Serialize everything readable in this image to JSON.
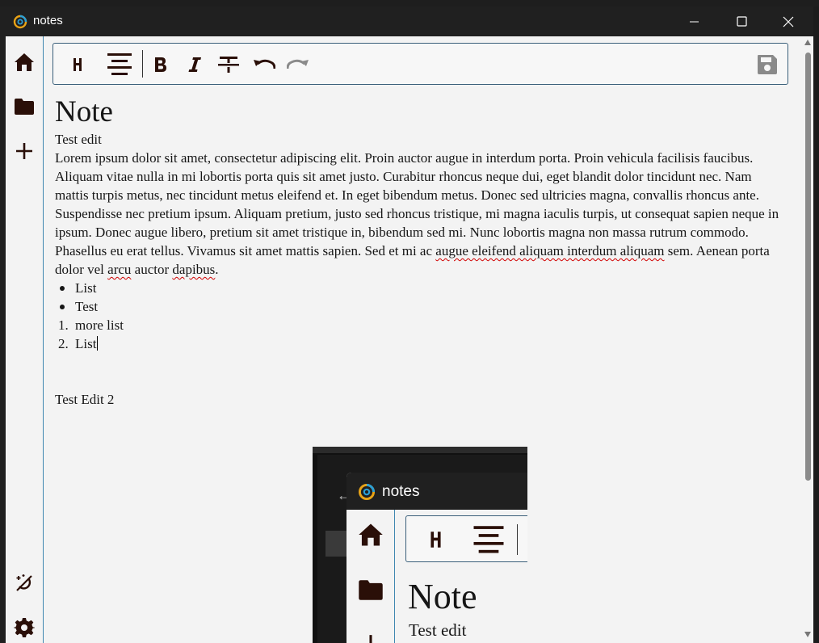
{
  "window": {
    "title": "notes",
    "controls": [
      "minimize",
      "maximize",
      "close"
    ]
  },
  "sidebar": {
    "top_items": [
      {
        "icon": "home-icon"
      },
      {
        "icon": "folder-icon"
      },
      {
        "icon": "plus-icon"
      }
    ],
    "bottom_items": [
      {
        "icon": "theme-toggle-icon"
      },
      {
        "icon": "gear-icon"
      }
    ]
  },
  "toolbar": {
    "buttons": [
      {
        "icon": "heading-icon",
        "label": "H"
      },
      {
        "icon": "align-center-icon"
      },
      {
        "icon": "bold-icon",
        "label": "B"
      },
      {
        "icon": "italic-icon",
        "label": "I"
      },
      {
        "icon": "strikethrough-icon"
      },
      {
        "icon": "undo-icon"
      },
      {
        "icon": "redo-icon"
      }
    ],
    "save": {
      "icon": "save-icon"
    }
  },
  "note": {
    "title": "Note",
    "subtitle": "Test edit",
    "paragraph_parts": [
      {
        "text": "Lorem ipsum dolor sit amet, consectetur adipiscing elit. Proin auctor augue in interdum porta. Proin vehicula facilisis faucibus. Aliquam vitae nulla in mi lobortis porta quis sit amet justo. Curabitur rhoncus neque dui, eget blandit dolor tincidunt nec. Nam mattis turpis metus, nec tincidunt metus eleifend et. In eget bibendum metus. Donec sed ultricies magna, convallis rhoncus ante. Suspendisse nec pretium ipsum. Aliquam pretium, justo sed rhoncus tristique, mi magna iaculis turpis, ut consequat sapien neque in ipsum. Donec augue libero, pretium sit amet tristique in, bibendum sed mi. Nunc lobortis magna non massa rutrum commodo. Phasellus eu erat tellus. Vivamus sit amet mattis sapien. Sed et mi ac ",
        "spell": false
      },
      {
        "text": "augue eleifend aliquam interdum aliquam",
        "spell": true
      },
      {
        "text": " sem. Aenean porta dolor vel ",
        "spell": false
      },
      {
        "text": "arcu",
        "spell": true
      },
      {
        "text": " auctor ",
        "spell": false
      },
      {
        "text": "dapibus",
        "spell": true
      },
      {
        "text": ".",
        "spell": false
      }
    ],
    "bullet_list": [
      "List",
      "Test"
    ],
    "numbered_list": [
      {
        "number": "1.",
        "text": "more list"
      },
      {
        "number": "2.",
        "text": "List"
      }
    ],
    "second_heading": "Test Edit 2",
    "embedded_image": {
      "app_title": "notes",
      "note_title": "Note",
      "note_subtitle": "Test edit",
      "toolbar_label": "H"
    }
  }
}
